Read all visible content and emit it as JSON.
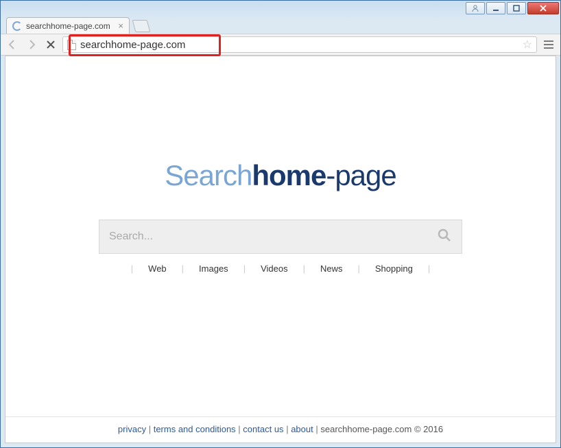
{
  "tab": {
    "title": "searchhome-page.com"
  },
  "addressbar": {
    "url": "searchhome-page.com"
  },
  "logo": {
    "part1": "Search",
    "part2": "home",
    "part3": "-page"
  },
  "search": {
    "placeholder": "Search..."
  },
  "categories": [
    "Web",
    "Images",
    "Videos",
    "News",
    "Shopping"
  ],
  "footer": {
    "links": [
      "privacy",
      "terms and conditions",
      "contact us",
      "about"
    ],
    "domain": "searchhome-page.com",
    "copyright": "© 2016"
  }
}
